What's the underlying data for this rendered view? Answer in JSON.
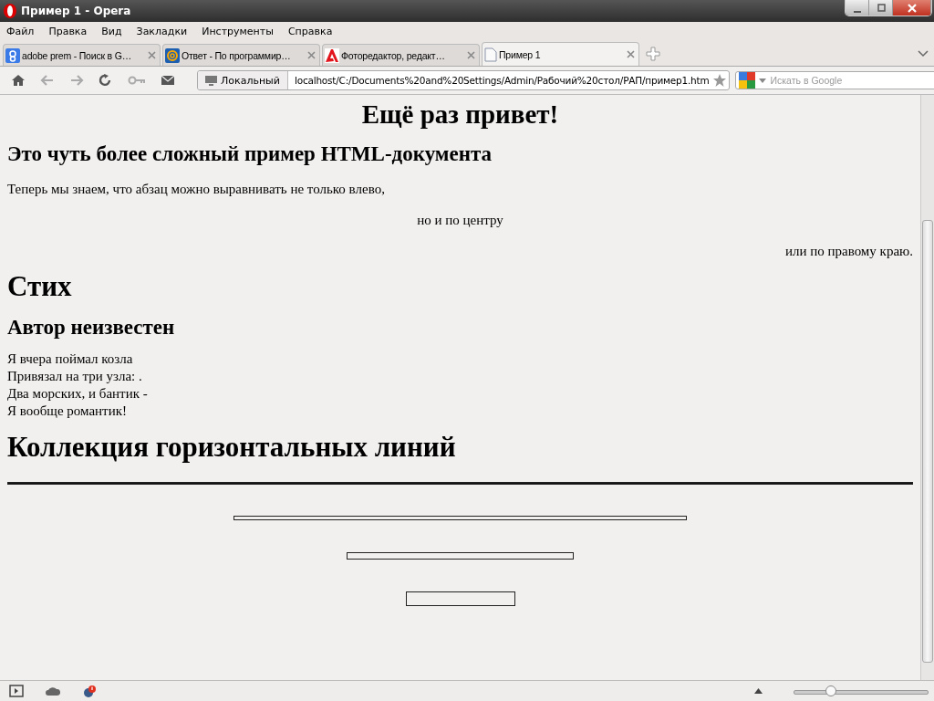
{
  "window": {
    "title": "Пример 1 - Opera"
  },
  "menu": [
    "Файл",
    "Правка",
    "Вид",
    "Закладки",
    "Инструменты",
    "Справка"
  ],
  "tabs": [
    {
      "kind": "google",
      "label": "adobe prem - Поиск в G…",
      "selected": false
    },
    {
      "kind": "mail",
      "label": "Ответ - По программир…",
      "selected": false
    },
    {
      "kind": "adobe",
      "label": "Фоторедактор, редакт…",
      "selected": false
    },
    {
      "kind": "page",
      "label": "Пример 1",
      "selected": true
    }
  ],
  "toolbar": {
    "site_badge": "Локальный",
    "address": "localhost/C:/Documents%20and%20Settings/Admin/Рабочий%20стол/РАП/пример1.htm",
    "search": {
      "placeholder": "Искать в Google"
    }
  },
  "page": [
    {
      "kind": "title",
      "text": "Ещё раз привет!"
    },
    {
      "kind": "h2",
      "text": "Это чуть более сложный пример HTML-документа"
    },
    {
      "kind": "pleft",
      "text": "Теперь мы знаем, что абзац можно выравнивать не только влево,"
    },
    {
      "kind": "pcenter",
      "text": "но и по центру"
    },
    {
      "kind": "pright",
      "text": "или по правому краю."
    },
    {
      "kind": "h1",
      "text": "Стих"
    },
    {
      "kind": "h2",
      "text": "Автор неизвестен"
    },
    {
      "kind": "lines",
      "lines": [
        "Я вчера поймал козла",
        "Привязал на три узла: .",
        "Два морских, и бантик -",
        "Я вообще романтик!"
      ]
    },
    {
      "kind": "h1",
      "text": "Коллекция горизонтальных линий"
    },
    {
      "kind": "rulefull"
    },
    {
      "kind": "rulehalf"
    },
    {
      "kind": "rulequarter"
    },
    {
      "kind": "rulesmall"
    }
  ],
  "status_bar": {
    "zoom": {
      "level": 0.28
    }
  }
}
